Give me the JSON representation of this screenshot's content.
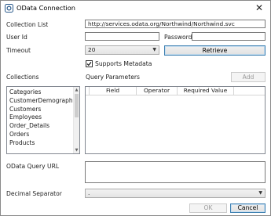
{
  "window": {
    "title": "OData Connection",
    "close_glyph": "✕"
  },
  "labels": {
    "collection_list": "Collection List",
    "user_id": "User Id",
    "password": "Password",
    "timeout": "Timeout",
    "collections": "Collections",
    "query_parameters": "Query Parameters",
    "odata_query_url": "OData Query URL",
    "decimal_separator": "Decimal Separator"
  },
  "fields": {
    "collection_list_value": "http://services.odata.org/Northwind/Northwind.svc",
    "user_id_value": "",
    "password_value": "",
    "timeout_value": "20",
    "odata_query_url_value": "",
    "decimal_separator_value": "."
  },
  "checkbox": {
    "supports_metadata_label": "Supports Metadata",
    "supports_metadata_checked": true
  },
  "buttons": {
    "retrieve": "Retrieve",
    "add": "Add",
    "ok": "OK",
    "cancel": "Cancel"
  },
  "collections": [
    "Categories",
    "CustomerDemographics",
    "Customers",
    "Employees",
    "Order_Details",
    "Orders",
    "Products"
  ],
  "query_grid": {
    "columns": [
      "Field",
      "Operator",
      "Required Value"
    ]
  },
  "icons": {
    "app": "odata-icon",
    "close": "close-icon",
    "dropdown": "chevron-down-icon",
    "check": "checkmark-icon",
    "scroll_up": "scroll-up-icon",
    "scroll_down": "scroll-down-icon"
  }
}
